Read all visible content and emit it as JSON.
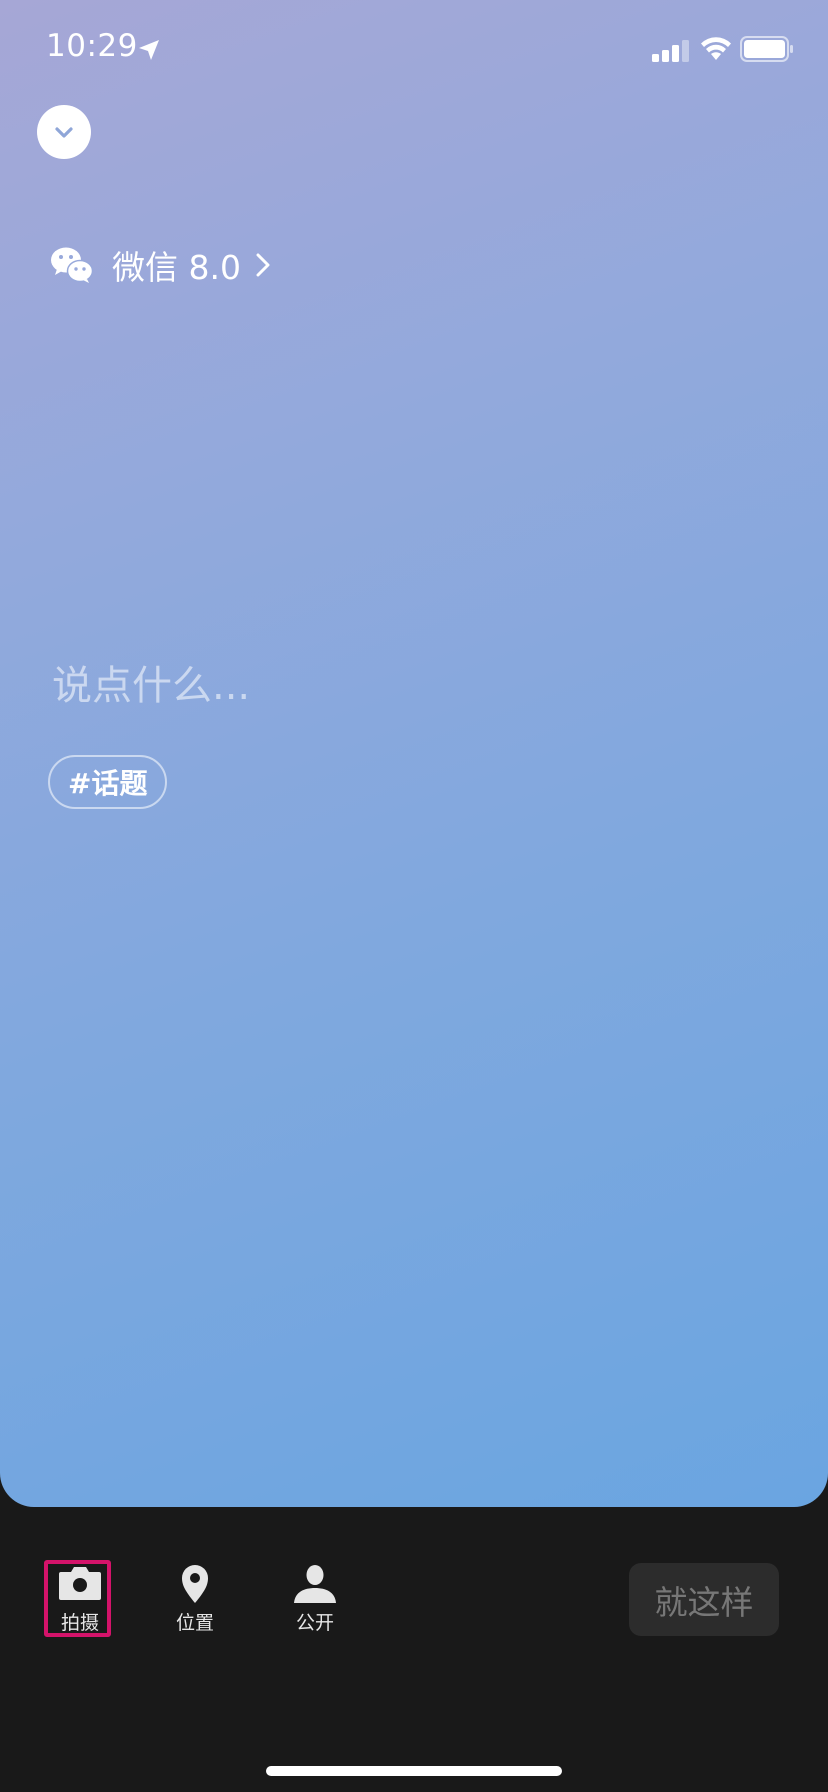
{
  "status_bar": {
    "time": "10:29"
  },
  "app_link": {
    "label": "微信 8.0"
  },
  "compose": {
    "placeholder": "说点什么...",
    "topic_chip": "#话题"
  },
  "toolbar": {
    "shoot_label": "拍摄",
    "location_label": "位置",
    "visibility_label": "公开",
    "done_label": "就这样"
  },
  "icons": {
    "collapse": "chevron-down-icon",
    "app": "wechat-icon",
    "app_arrow": "chevron-right-icon",
    "shoot": "camera-icon",
    "location": "location-pin-icon",
    "visibility": "person-icon"
  },
  "colors": {
    "gradient_start": "#a6a7d6",
    "gradient_end": "#6aa5e1",
    "toolbar_bg": "#191919",
    "highlight": "#d4136a",
    "done_button_bg": "#2c2c2c",
    "done_button_text": "#777777"
  }
}
